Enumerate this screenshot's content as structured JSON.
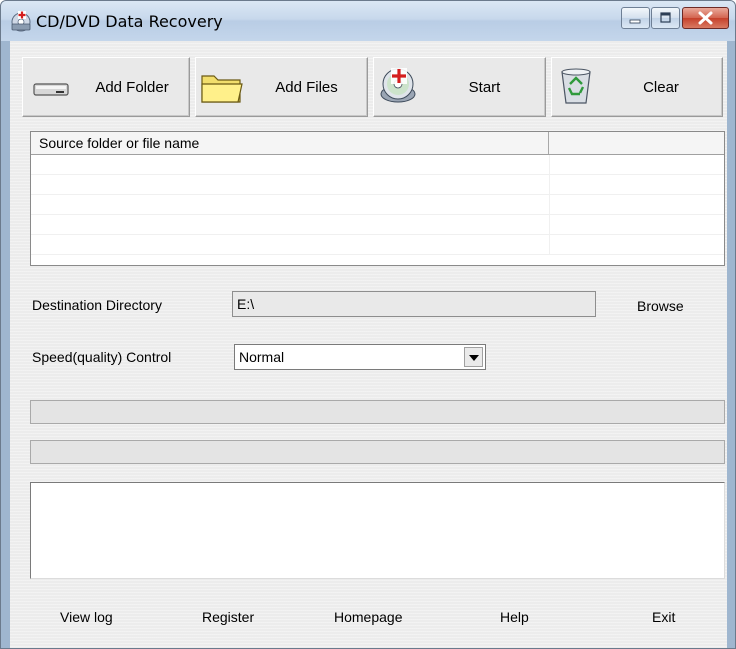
{
  "window": {
    "title": "CD/DVD Data Recovery"
  },
  "toolbar": {
    "add_folder": "Add Folder",
    "add_files": "Add Files",
    "start": "Start",
    "clear": "Clear"
  },
  "file_list": {
    "columns": [
      "Source folder or file name",
      ""
    ],
    "rows": []
  },
  "destination": {
    "label": "Destination Directory",
    "value": "E:\\",
    "browse": "Browse"
  },
  "speed": {
    "label": "Speed(quality) Control",
    "selected": "Normal"
  },
  "progress": {
    "bar1": 0,
    "bar2": 0
  },
  "log_text": "",
  "footer": {
    "view_log": "View log",
    "register": "Register",
    "homepage": "Homepage",
    "help": "Help",
    "exit": "Exit"
  },
  "icons": {
    "app": "cd-recovery-icon",
    "add_folder": "drive-icon",
    "add_files": "folder-icon",
    "start": "disc-plus-icon",
    "clear": "recycle-bin-icon"
  },
  "colors": {
    "titlebar": "#c7d8ec",
    "close_button": "#c5402b",
    "panel": "#ececec"
  }
}
